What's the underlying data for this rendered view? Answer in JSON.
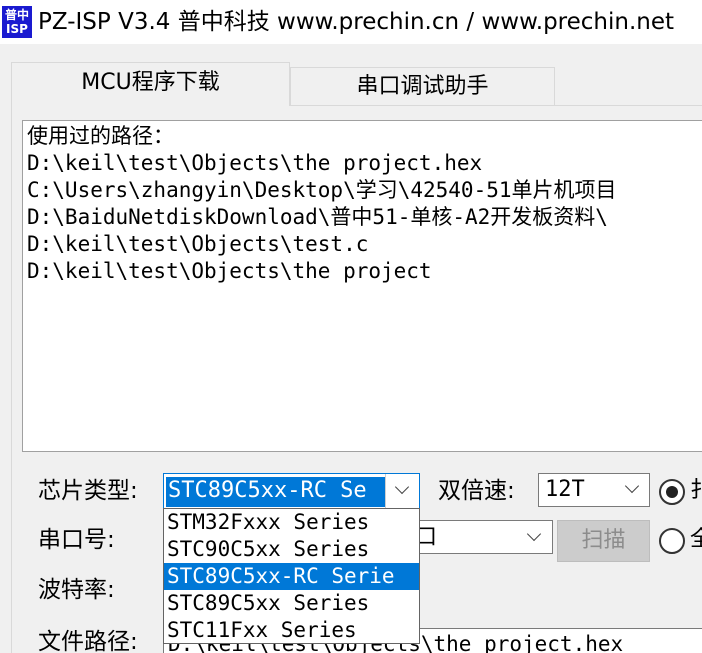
{
  "window": {
    "icon_text": "普中ISP",
    "title": "PZ-ISP V3.4 普中科技  www.prechin.cn / www.prechin.net"
  },
  "tabs": [
    {
      "label": "MCU程序下载",
      "active": true
    },
    {
      "label": "串口调试助手",
      "active": false
    }
  ],
  "history": {
    "heading": "使用过的路径：",
    "paths": [
      "D:\\keil\\test\\Objects\\the project.hex",
      "C:\\Users\\zhangyin\\Desktop\\学习\\42540-51单片机项目",
      "D:\\BaiduNetdiskDownload\\普中51-单核-A2开发板资料\\",
      "D:\\keil\\test\\Objects\\test.c",
      "D:\\keil\\test\\Objects\\the project"
    ]
  },
  "form": {
    "chip_type_label": "芯片类型:",
    "chip_type_value": "STC89C5xx-RC Se",
    "double_speed_label": "双倍速:",
    "double_speed_value": "12T",
    "radio1_label": "扌",
    "port_label": "串口号:",
    "port_value": "口",
    "scan_button": "扫描",
    "radio2_label": "全",
    "baud_label": "波特率:",
    "file_path_label": "文件路径:",
    "file_path_value": "D:\\keil\\test\\Objects\\the project.hex"
  },
  "chip_dropdown": {
    "options": [
      "STM32Fxxx Series",
      "STC90C5xx Series",
      "STC89C5xx-RC Serie",
      "STC89C5xx Series",
      "STC11Fxx Series"
    ],
    "selected_index": 2
  },
  "colors": {
    "accent": "#0078d7",
    "icon_bg": "#1a1ad0"
  }
}
